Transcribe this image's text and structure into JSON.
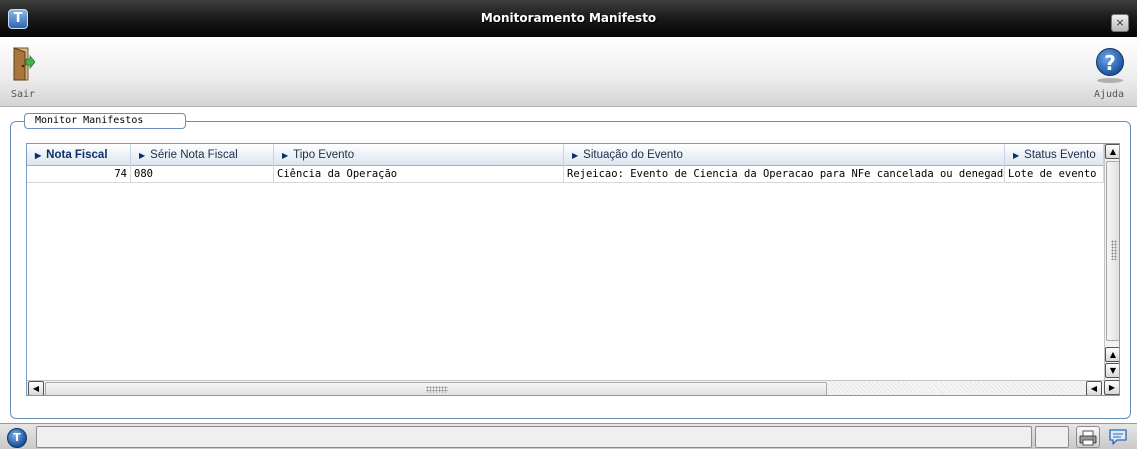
{
  "window": {
    "title": "Monitoramento Manifesto",
    "close_glyph": "×"
  },
  "toolbar": {
    "exit_label": "Sair",
    "help_label": "Ajuda",
    "help_glyph": "?"
  },
  "group": {
    "title": "Monitor Manifestos"
  },
  "grid": {
    "columns": [
      {
        "label": "Nota Fiscal",
        "active": true
      },
      {
        "label": "Série Nota Fiscal"
      },
      {
        "label": "Tipo Evento"
      },
      {
        "label": "Situação do Evento"
      },
      {
        "label": "Status Evento"
      }
    ],
    "rows": [
      {
        "nota_fiscal": "74",
        "serie": "080",
        "tipo_evento": "Ciência da Operação",
        "situacao": "Rejeicao: Evento de Ciencia da Operacao para NFe cancelada ou denegada",
        "status": "Lote de evento p"
      }
    ],
    "scroll": {
      "up": "▲",
      "down": "▼",
      "left": "◀",
      "right": "▶"
    }
  },
  "statusbar": {
    "logo_glyph": "T",
    "printer_icon": "printer-icon",
    "chat_icon": "chat-icon"
  }
}
